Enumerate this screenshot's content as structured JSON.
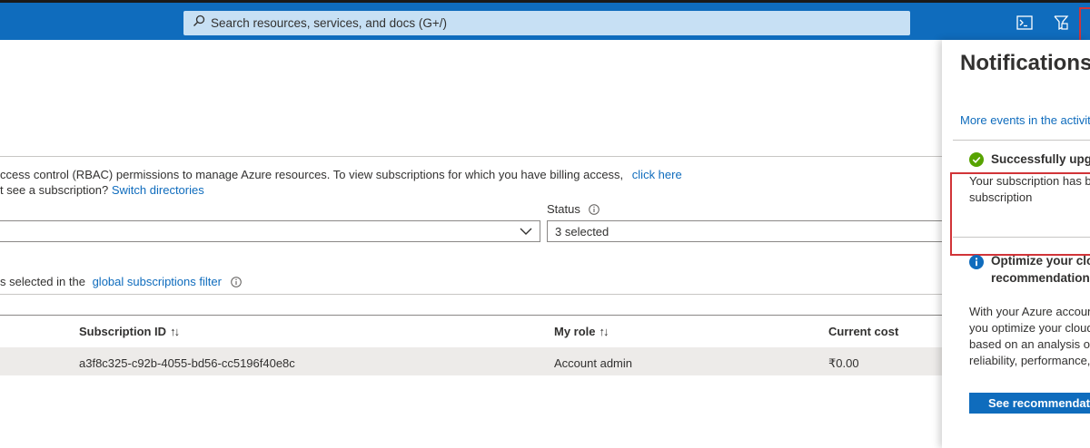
{
  "topbar": {
    "search_placeholder": "Search resources, services, and docs (G+/)",
    "icons": [
      "search-icon",
      "cloud-shell-icon",
      "directory-filter-icon"
    ]
  },
  "page": {
    "info_line1_text": "ccess control (RBAC) permissions to manage Azure resources. To view subscriptions for which you have billing access,",
    "info_line1_link": "click here",
    "info_line2_text": "t see a subscription?",
    "info_line2_link": "Switch directories",
    "status_label": "Status",
    "status_value": "3 selected",
    "filter_text": "s selected in the",
    "filter_link": "global subscriptions filter",
    "table": {
      "columns": [
        "Subscription ID",
        "My role",
        "Current cost"
      ],
      "rows": [
        {
          "subscription_id": "a3f8c325-c92b-4055-bd56-cc5196f40e8c",
          "role": "Account admin",
          "cost": "₹0.00"
        }
      ]
    }
  },
  "notifications": {
    "title": "Notifications",
    "more_events": "More events in the activit",
    "items": [
      {
        "title": "Successfully upgr",
        "line1": "Your subscription has b",
        "line2": "subscription",
        "status_color": "#57a300"
      },
      {
        "title_line1": "Optimize your clo",
        "title_line2": "recommendation",
        "body": [
          "With your Azure accoun",
          "you optimize your cloud",
          "based on an analysis of",
          "reliability, performance,"
        ],
        "button": "See recommendatio",
        "status_color": "#0f6cbd"
      }
    ]
  },
  "colors": {
    "accent": "#0f6cbd",
    "highlight": "#d13438"
  }
}
